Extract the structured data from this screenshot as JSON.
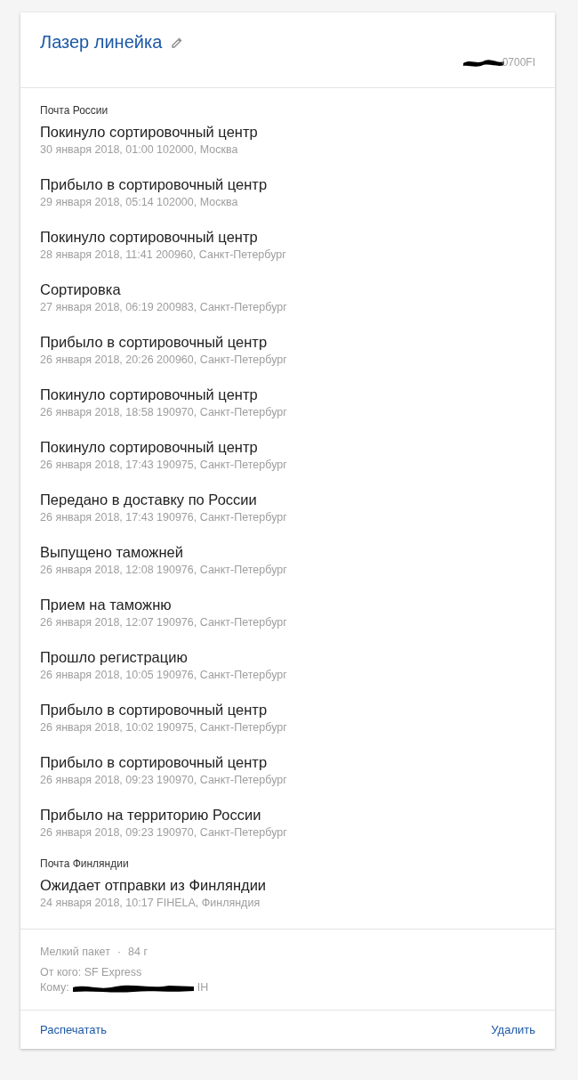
{
  "header": {
    "title": "Лазер линейка",
    "tracking_number_visible": "0700FI"
  },
  "groups": [
    {
      "carrier": "Почта России",
      "events": [
        {
          "status": "Покинуло сортировочный центр",
          "details": "30 января 2018, 01:00 102000, Москва"
        },
        {
          "status": "Прибыло в сортировочный центр",
          "details": "29 января 2018, 05:14 102000, Москва"
        },
        {
          "status": "Покинуло сортировочный центр",
          "details": "28 января 2018, 11:41 200960, Санкт-Петербург"
        },
        {
          "status": "Сортировка",
          "details": "27 января 2018, 06:19 200983, Санкт-Петербург"
        },
        {
          "status": "Прибыло в сортировочный центр",
          "details": "26 января 2018, 20:26 200960, Санкт-Петербург"
        },
        {
          "status": "Покинуло сортировочный центр",
          "details": "26 января 2018, 18:58 190970, Санкт-Петербург"
        },
        {
          "status": "Покинуло сортировочный центр",
          "details": "26 января 2018, 17:43 190975, Санкт-Петербург"
        },
        {
          "status": "Передано в доставку по России",
          "details": "26 января 2018, 17:43 190976, Санкт-Петербург"
        },
        {
          "status": "Выпущено таможней",
          "details": "26 января 2018, 12:08 190976, Санкт-Петербург"
        },
        {
          "status": "Прием на таможню",
          "details": "26 января 2018, 12:07 190976, Санкт-Петербург"
        },
        {
          "status": "Прошло регистрацию",
          "details": "26 января 2018, 10:05 190976, Санкт-Петербург"
        },
        {
          "status": "Прибыло в сортировочный центр",
          "details": "26 января 2018, 10:02 190975, Санкт-Петербург"
        },
        {
          "status": "Прибыло в сортировочный центр",
          "details": "26 января 2018, 09:23 190970, Санкт-Петербург"
        },
        {
          "status": "Прибыло на территорию России",
          "details": "26 января 2018, 09:23 190970, Санкт-Петербург"
        }
      ]
    },
    {
      "carrier": "Почта Финляндии",
      "events": [
        {
          "status": "Ожидает отправки из Финляндии",
          "details": "24 января 2018, 10:17 FIHELA, Финляндия"
        }
      ]
    }
  ],
  "parcel": {
    "type": "Мелкий пакет",
    "separator": "·",
    "weight": "84 г",
    "from": "От кого: SF Express",
    "to_label": "Кому:",
    "to_visible": "IH"
  },
  "actions": [
    {
      "label": "Распечатать"
    },
    {
      "label": "Удалить"
    }
  ]
}
